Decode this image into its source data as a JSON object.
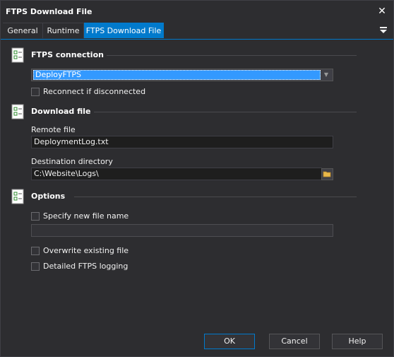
{
  "window": {
    "title": "FTPS Download File"
  },
  "tabs": [
    {
      "label": "General"
    },
    {
      "label": "Runtime"
    },
    {
      "label": "FTPS Download File",
      "active": true
    }
  ],
  "sections": {
    "connection": {
      "title": "FTPS connection",
      "selected_connection": "DeployFTPS",
      "reconnect_label": "Reconnect if disconnected",
      "reconnect_checked": false
    },
    "download": {
      "title": "Download file",
      "remote_file_label": "Remote file",
      "remote_file_value": "DeploymentLog.txt",
      "dest_dir_label": "Destination directory",
      "dest_dir_value": "C:\\Website\\Logs\\"
    },
    "options": {
      "title": "Options",
      "specify_new_name_label": "Specify new file name",
      "specify_new_name_checked": false,
      "new_name_value": "",
      "overwrite_label": "Overwrite existing file",
      "overwrite_checked": false,
      "detailed_logging_label": "Detailed FTPS logging",
      "detailed_logging_checked": false
    }
  },
  "buttons": {
    "ok": "OK",
    "cancel": "Cancel",
    "help": "Help"
  },
  "icons": {
    "close": "close-icon",
    "menu": "hamburger-dropdown-icon",
    "section": "checklist-icon",
    "folder": "folder-icon",
    "dropdown": "chevron-down-icon"
  },
  "colors": {
    "background": "#2d2d30",
    "accent": "#007acc",
    "selection": "#3399ff",
    "text": "#f1f1f1",
    "input_background": "#1e1e1e"
  }
}
